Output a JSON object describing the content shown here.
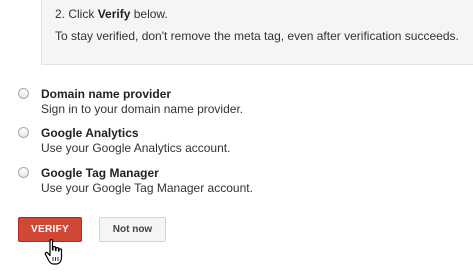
{
  "instructions": {
    "step_prefix": "2. Click ",
    "step_bold": "Verify",
    "step_suffix": " below.",
    "note": "To stay verified, don't remove the meta tag, even after verification succeeds."
  },
  "options": [
    {
      "title": "Domain name provider",
      "description": "Sign in to your domain name provider."
    },
    {
      "title": "Google Analytics",
      "description": "Use your Google Analytics account."
    },
    {
      "title": "Google Tag Manager",
      "description": "Use your Google Tag Manager account."
    }
  ],
  "buttons": {
    "verify_label": "VERIFY",
    "not_now_label": "Not now"
  },
  "colors": {
    "verify_button": "#d14836",
    "panel_background": "#f5f5f5"
  },
  "cursor_icon": "hand-pointer-icon"
}
